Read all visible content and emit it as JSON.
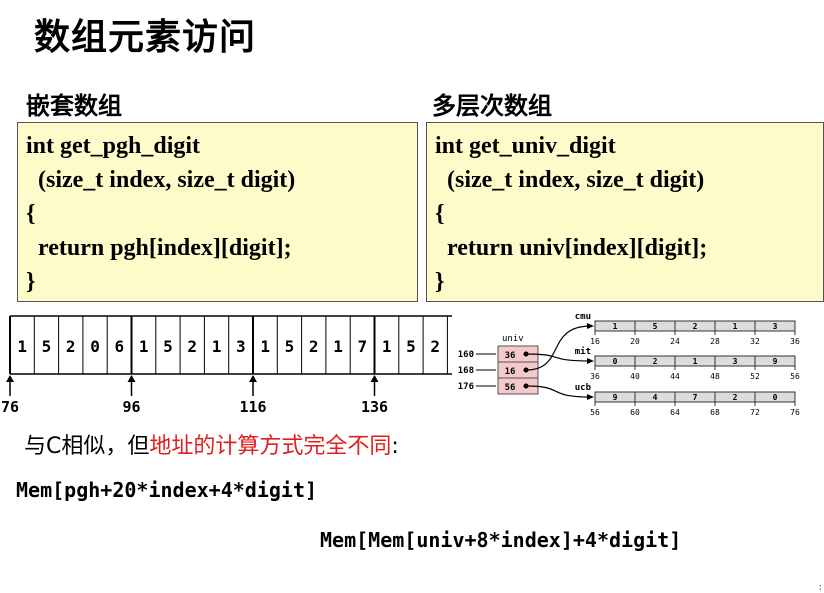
{
  "title": "数组元素访问",
  "nested": {
    "heading": "嵌套数组",
    "code": [
      "int get_pgh_digit",
      "  (size_t index, size_t digit)",
      "{",
      "  return pgh[index][digit];",
      "}"
    ]
  },
  "multi": {
    "heading": "多层次数组",
    "code": [
      "int get_univ_digit",
      "  (size_t index, size_t digit)",
      "{",
      "  return univ[index][digit];",
      "}"
    ]
  },
  "chart_data": [
    {
      "type": "table",
      "description_kind": "memory layout of nested array pgh",
      "cells": [
        "1",
        "5",
        "2",
        "0",
        "6",
        "1",
        "5",
        "2",
        "1",
        "3",
        "1",
        "5",
        "2",
        "1",
        "7",
        "1",
        "5",
        "2"
      ],
      "address_labels": [
        "76",
        "96",
        "116",
        "136"
      ]
    },
    {
      "type": "table",
      "description_kind": "pointer array univ",
      "pointer_label": "univ",
      "pointer_addresses": [
        "160",
        "168",
        "176"
      ],
      "pointer_values": [
        "36",
        "16",
        "56"
      ],
      "rows": [
        {
          "name": "cmu",
          "digits": [
            "1",
            "5",
            "2",
            "1",
            "3"
          ],
          "addresses": [
            "16",
            "20",
            "24",
            "28",
            "32",
            "36"
          ]
        },
        {
          "name": "mit",
          "digits": [
            "0",
            "2",
            "1",
            "3",
            "9"
          ],
          "addresses": [
            "36",
            "40",
            "44",
            "48",
            "52",
            "56"
          ]
        },
        {
          "name": "ucb",
          "digits": [
            "9",
            "4",
            "7",
            "2",
            "0"
          ],
          "addresses": [
            "56",
            "60",
            "64",
            "68",
            "72",
            "76"
          ]
        }
      ]
    }
  ],
  "note": {
    "prefix": "与C相似，但",
    "highlight": "地址的计算方式完全不同",
    "suffix": ":"
  },
  "formulas": {
    "nested": "Mem[pgh+20*index+4*digit]",
    "multi": "Mem[Mem[univ+8*index]+4*digit]"
  },
  "page_marker": ":"
}
